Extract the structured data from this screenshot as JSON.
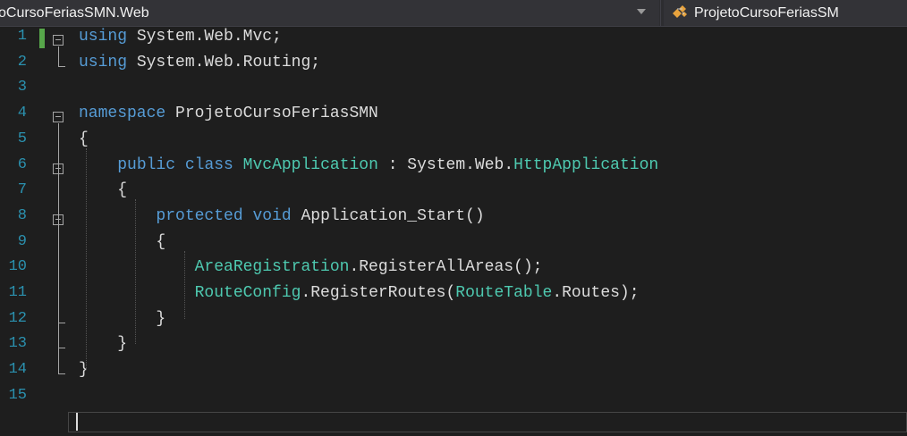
{
  "navbar": {
    "project_dropdown": "oCursoFeriasSMN.Web",
    "class_dropdown": "ProjetoCursoFeriasSM"
  },
  "editor": {
    "line_numbers": [
      "1",
      "2",
      "3",
      "4",
      "5",
      "6",
      "7",
      "8",
      "9",
      "10",
      "11",
      "12",
      "13",
      "14",
      "15"
    ],
    "lines": [
      [
        {
          "t": "using",
          "k": "kw"
        },
        {
          "t": " System.Web.Mvc;",
          "k": ""
        }
      ],
      [
        {
          "t": "using",
          "k": "kw"
        },
        {
          "t": " System.Web.Routing;",
          "k": ""
        }
      ],
      [],
      [
        {
          "t": "namespace",
          "k": "kw"
        },
        {
          "t": " ProjetoCursoFeriasSMN",
          "k": ""
        }
      ],
      [
        {
          "t": "{",
          "k": ""
        }
      ],
      [
        {
          "t": "    ",
          "k": ""
        },
        {
          "t": "public",
          "k": "kw"
        },
        {
          "t": " ",
          "k": ""
        },
        {
          "t": "class",
          "k": "kw"
        },
        {
          "t": " ",
          "k": ""
        },
        {
          "t": "MvcApplication",
          "k": "ty"
        },
        {
          "t": " : System.Web.",
          "k": ""
        },
        {
          "t": "HttpApplication",
          "k": "ty"
        }
      ],
      [
        {
          "t": "    {",
          "k": ""
        }
      ],
      [
        {
          "t": "        ",
          "k": ""
        },
        {
          "t": "protected",
          "k": "kw"
        },
        {
          "t": " ",
          "k": ""
        },
        {
          "t": "void",
          "k": "kw"
        },
        {
          "t": " Application_Start()",
          "k": ""
        }
      ],
      [
        {
          "t": "        {",
          "k": ""
        }
      ],
      [
        {
          "t": "            ",
          "k": ""
        },
        {
          "t": "AreaRegistration",
          "k": "ty"
        },
        {
          "t": ".RegisterAllAreas();",
          "k": ""
        }
      ],
      [
        {
          "t": "            ",
          "k": ""
        },
        {
          "t": "RouteConfig",
          "k": "ty"
        },
        {
          "t": ".RegisterRoutes(",
          "k": ""
        },
        {
          "t": "RouteTable",
          "k": "ty"
        },
        {
          "t": ".Routes);",
          "k": ""
        }
      ],
      [
        {
          "t": "        }",
          "k": ""
        }
      ],
      [
        {
          "t": "    }",
          "k": ""
        }
      ],
      [
        {
          "t": "}",
          "k": ""
        }
      ],
      []
    ]
  }
}
